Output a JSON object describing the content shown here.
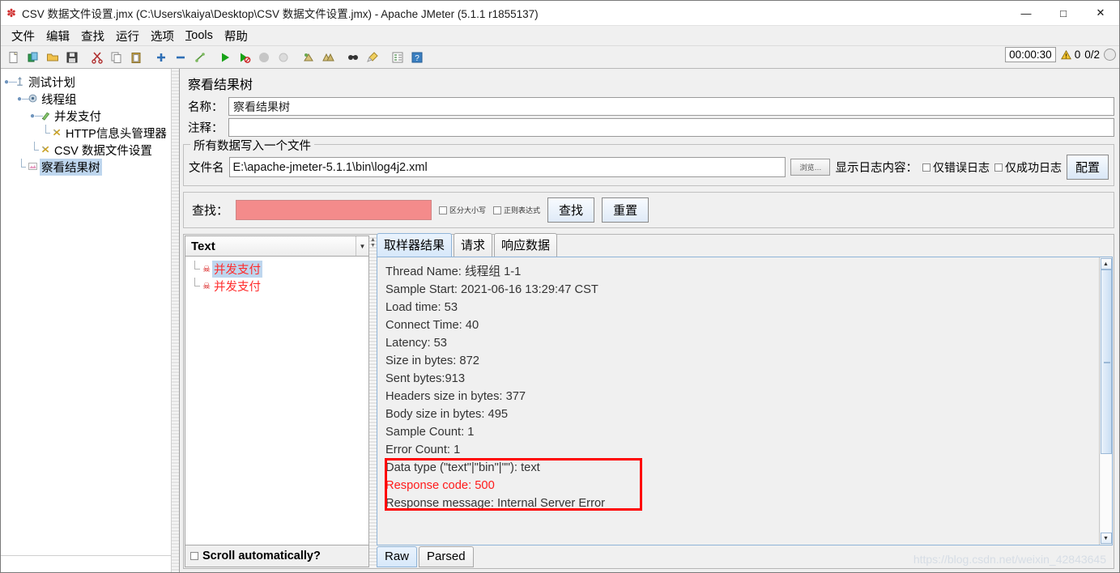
{
  "window": {
    "title": "CSV 数据文件设置.jmx (C:\\Users\\kaiya\\Desktop\\CSV 数据文件设置.jmx) - Apache JMeter (5.1.1 r1855137)",
    "app_icon": "jmeter-feather-icon",
    "minimize_label": "—",
    "maximize_label": "□",
    "close_label": "✕"
  },
  "menubar": {
    "items": [
      {
        "label": "文件",
        "name": "menu-file"
      },
      {
        "label": "编辑",
        "name": "menu-edit"
      },
      {
        "label": "查找",
        "name": "menu-search"
      },
      {
        "label": "运行",
        "name": "menu-run"
      },
      {
        "label": "选项",
        "name": "menu-options"
      },
      {
        "label": "Tools",
        "name": "menu-tools",
        "mnemonic": "T"
      },
      {
        "label": "帮助",
        "name": "menu-help"
      }
    ]
  },
  "toolbar": {
    "buttons": [
      {
        "name": "new-icon",
        "title": "New"
      },
      {
        "name": "templates-icon",
        "title": "Templates"
      },
      {
        "name": "open-icon",
        "title": "Open"
      },
      {
        "name": "save-icon",
        "title": "Save"
      },
      {
        "name": "cut-icon",
        "title": "Cut"
      },
      {
        "name": "copy-icon",
        "title": "Copy"
      },
      {
        "name": "paste-icon",
        "title": "Paste"
      },
      {
        "name": "expand-all-icon",
        "title": "Expand All"
      },
      {
        "name": "collapse-all-icon",
        "title": "Collapse All"
      },
      {
        "name": "toggle-icon",
        "title": "Toggle"
      },
      {
        "name": "start-icon",
        "title": "Start"
      },
      {
        "name": "start-no-pauses-icon",
        "title": "Start no pauses"
      },
      {
        "name": "stop-icon",
        "title": "Stop"
      },
      {
        "name": "shutdown-icon",
        "title": "Shutdown"
      },
      {
        "name": "clear-icon",
        "title": "Clear"
      },
      {
        "name": "clear-all-icon",
        "title": "Clear All"
      },
      {
        "name": "search-icon",
        "title": "Search"
      },
      {
        "name": "search-reset-icon",
        "title": "Reset Search"
      },
      {
        "name": "function-helper-icon",
        "title": "Function Helper Dialog"
      },
      {
        "name": "help-icon",
        "title": "Help"
      }
    ]
  },
  "status": {
    "timer": "00:00:30",
    "warning_icon": "warning-triangle-icon",
    "warning_count": "0",
    "threads": "0/2",
    "remote_icon": "remote-status-icon"
  },
  "tree": {
    "nodes": [
      {
        "label": "测试计划",
        "icon": "test-plan-icon",
        "depth": 0,
        "selected": false,
        "handle": "expanded"
      },
      {
        "label": "线程组",
        "icon": "thread-group-icon",
        "depth": 1,
        "selected": false,
        "handle": "expanded"
      },
      {
        "label": "并发支付",
        "icon": "http-sampler-icon",
        "depth": 2,
        "selected": false,
        "handle": "expanded"
      },
      {
        "label": "HTTP信息头管理器",
        "icon": "header-manager-icon",
        "depth": 3,
        "selected": false,
        "handle": "leaf"
      },
      {
        "label": "CSV 数据文件设置",
        "icon": "csv-dataset-icon",
        "depth": 2,
        "selected": false,
        "handle": "leaf"
      },
      {
        "label": "察看结果树",
        "icon": "view-results-tree-icon",
        "depth": 1,
        "selected": true,
        "handle": "leaf"
      }
    ]
  },
  "panel": {
    "title": "察看结果树",
    "name_label": "名称：",
    "name_value": "察看结果树",
    "comment_label": "注释：",
    "comment_value": ""
  },
  "file_group": {
    "legend": "所有数据写入一个文件",
    "filename_label": "文件名",
    "filename_value": "E:\\apache-jmeter-5.1.1\\bin\\log4j2.xml",
    "browse_label": "浏览…",
    "display_label": "显示日志内容：",
    "errors_only_label": "仅错误日志",
    "errors_only_checked": false,
    "success_only_label": "仅成功日志",
    "success_only_checked": false,
    "configure_label": "配置"
  },
  "search": {
    "label": "查找：",
    "value": "",
    "input_color": "#f48b8b",
    "case_sensitive_label": "区分大小写",
    "case_sensitive_checked": false,
    "regex_label": "正则表达式",
    "regex_checked": false,
    "find_button": "查找",
    "reset_button": "重置"
  },
  "results": {
    "render_selected": "Text",
    "items": [
      {
        "label": "并发支付",
        "status": "error",
        "selected": true
      },
      {
        "label": "并发支付",
        "status": "error",
        "selected": false
      }
    ],
    "scroll_auto_label": "Scroll automatically?",
    "scroll_auto_checked": false,
    "tabs": [
      {
        "label": "取样器结果",
        "active": true
      },
      {
        "label": "请求",
        "active": false
      },
      {
        "label": "响应数据",
        "active": false
      }
    ],
    "detail_lines": [
      {
        "text": "Thread Name: 线程组 1-1",
        "error": false
      },
      {
        "text": "Sample Start: 2021-06-16 13:29:47 CST",
        "error": false
      },
      {
        "text": "Load time: 53",
        "error": false
      },
      {
        "text": "Connect Time: 40",
        "error": false
      },
      {
        "text": "Latency: 53",
        "error": false
      },
      {
        "text": "Size in bytes: 872",
        "error": false
      },
      {
        "text": "Sent bytes:913",
        "error": false
      },
      {
        "text": "Headers size in bytes: 377",
        "error": false
      },
      {
        "text": "Body size in bytes: 495",
        "error": false
      },
      {
        "text": "Sample Count: 1",
        "error": false
      },
      {
        "text": "Error Count: 1",
        "error": false
      },
      {
        "text": "Data type (\"text\"|\"bin\"|\"\"): text",
        "error": false
      },
      {
        "text": "Response code: 500",
        "error": true
      },
      {
        "text": "Response message: Internal Server Error",
        "error": false
      }
    ],
    "bottom_tabs": [
      {
        "label": "Raw",
        "active": true
      },
      {
        "label": "Parsed",
        "active": false
      }
    ]
  },
  "watermark": "https://blog.csdn.net/weixin_42843645"
}
